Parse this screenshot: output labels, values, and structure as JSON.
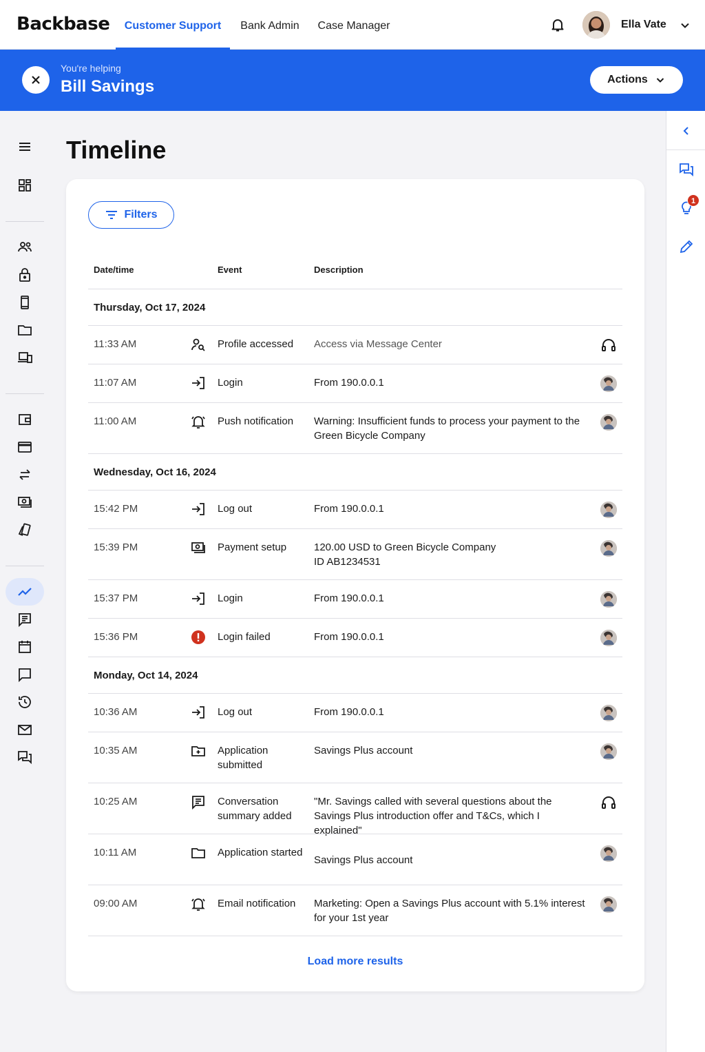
{
  "brand": "Backbase",
  "nav": {
    "tabs": [
      "Customer Support",
      "Bank Admin",
      "Case Manager"
    ],
    "active_tab": "Customer Support"
  },
  "user": {
    "name": "Ella Vate"
  },
  "banner": {
    "helping_label": "You're helping",
    "customer_name": "Bill Savings",
    "actions_label": "Actions"
  },
  "page": {
    "title": "Timeline"
  },
  "filters_label": "Filters",
  "table": {
    "headers": [
      "Date/time",
      "Event",
      "Description"
    ],
    "groups": [
      {
        "day": "Thursday, Oct 17, 2024",
        "rows": [
          {
            "time": "11:33 AM",
            "event": "Profile accessed",
            "event_icon": "profile-search-icon",
            "description": "Access via Message Center",
            "actor": "agent-headset-icon"
          },
          {
            "time": "11:07 AM",
            "event": "Login",
            "event_icon": "login-icon",
            "description": "From 190.0.0.1",
            "actor": "customer-avatar"
          },
          {
            "time": "11:00 AM",
            "event": "Push notification",
            "event_icon": "notification-bell-icon",
            "description": "Warning: Insufficient funds to process your payment to the Green Bicycle Company",
            "actor": "customer-avatar"
          }
        ]
      },
      {
        "day": "Wednesday, Oct 16, 2024",
        "rows": [
          {
            "time": "15:42 PM",
            "event": "Log out",
            "event_icon": "logout-icon",
            "description": "From 190.0.0.1",
            "actor": "customer-avatar"
          },
          {
            "time": "15:39 PM",
            "event": "Payment setup",
            "event_icon": "payment-icon",
            "description": "120.00 USD to Green Bicycle Company",
            "description_2": "ID AB1234531",
            "actor": "customer-avatar"
          },
          {
            "time": "15:37 PM",
            "event": "Login",
            "event_icon": "login-icon",
            "description": "From 190.0.0.1",
            "actor": "customer-avatar"
          },
          {
            "time": "15:36 PM",
            "event": "Login failed",
            "event_icon": "error-icon",
            "description": "From 190.0.0.1",
            "actor": "customer-avatar"
          }
        ]
      },
      {
        "day": "Monday, Oct 14, 2024",
        "rows": [
          {
            "time": "10:36 AM",
            "event": "Log out",
            "event_icon": "logout-icon",
            "description": "From 190.0.0.1",
            "actor": "customer-avatar"
          },
          {
            "time": "10:35 AM",
            "event": "Application submitted",
            "event_icon": "folder-plus-icon",
            "description": "Savings Plus account",
            "actor": "customer-avatar"
          },
          {
            "time": "10:25 AM",
            "event": "Conversation summary added",
            "event_icon": "summary-icon",
            "description": "\"Mr. Savings called with several questions about the Savings Plus introduction offer and T&Cs, which I explained\"",
            "actor": "agent-headset-icon"
          },
          {
            "time": "10:11 AM",
            "event": "Application started",
            "event_icon": "folder-icon",
            "description": "Savings Plus account",
            "actor": "customer-avatar"
          },
          {
            "time": "09:00 AM",
            "event": "Email notification",
            "event_icon": "notification-bell-icon",
            "description": "Marketing: Open a Savings Plus account with 5.1% interest for your 1st year",
            "actor": "customer-avatar"
          }
        ]
      }
    ]
  },
  "load_more_label": "Load more results",
  "right_rail": {
    "badge_count": "1"
  },
  "colors": {
    "primary": "#1e63e9",
    "error": "#d0321e",
    "active_bg": "#dfe7fb"
  }
}
